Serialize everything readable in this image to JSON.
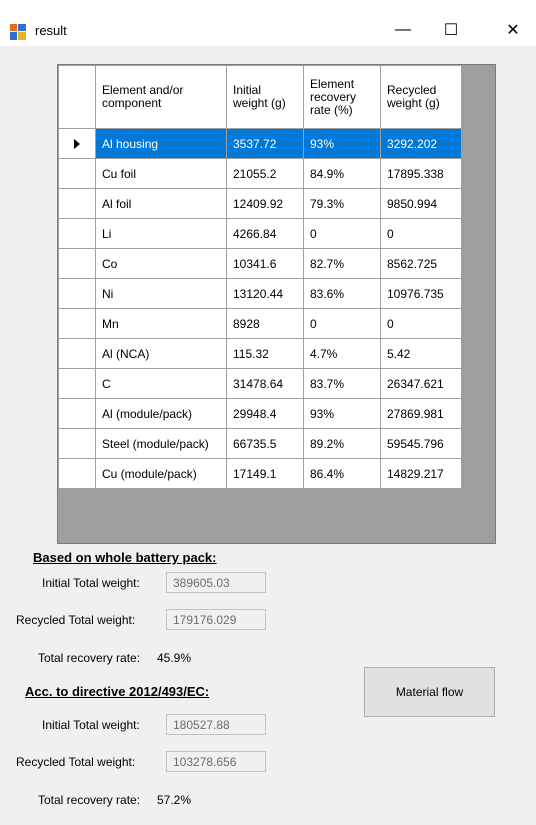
{
  "window": {
    "title": "result",
    "minimize_glyph": "—",
    "maximize_glyph": "☐",
    "close_glyph": "✕"
  },
  "table": {
    "headers": [
      "Element and/or component",
      "Initial weight (g)",
      "Element recovery rate (%)",
      "Recycled weight (g)"
    ],
    "header_lines": [
      [
        "Element and/or",
        "component"
      ],
      [
        "Initial",
        "weight (g)"
      ],
      [
        "Element",
        "recovery",
        "rate (%)"
      ],
      [
        "Recycled",
        "weight (g)"
      ]
    ],
    "rows": [
      [
        "Al housing",
        "3537.72",
        "93%",
        "3292.202"
      ],
      [
        "Cu foil",
        "21055.2",
        "84.9%",
        "17895.338"
      ],
      [
        "Al foil",
        "12409.92",
        "79.3%",
        "9850.994"
      ],
      [
        "Li",
        "4266.84",
        "0",
        "0"
      ],
      [
        "Co",
        "10341.6",
        "82.7%",
        "8562.725"
      ],
      [
        "Ni",
        "13120.44",
        "83.6%",
        "10976.735"
      ],
      [
        "Mn",
        "8928",
        "0",
        "0"
      ],
      [
        "Al (NCA)",
        "115.32",
        "4.7%",
        "5.42"
      ],
      [
        "C",
        "31478.64",
        "83.7%",
        "26347.621"
      ],
      [
        "Al (module/pack)",
        "29948.4",
        "93%",
        "27869.981"
      ],
      [
        "Steel (module/pack)",
        "66735.5",
        "89.2%",
        "59545.796"
      ],
      [
        "Cu (module/pack)",
        "17149.1",
        "86.4%",
        "14829.217"
      ]
    ],
    "selected_row": 0
  },
  "whole_pack": {
    "title": "Based on whole battery pack:",
    "initial_label": "Initial Total weight:",
    "initial_value": "389605.03",
    "recycled_label": "Recycled Total weight:",
    "recycled_value": "179176.029",
    "rate_label": "Total recovery rate:",
    "rate_value": "45.9%"
  },
  "directive": {
    "title": "Acc. to directive 2012/493/EC:",
    "initial_label": "Initial Total weight:",
    "initial_value": "180527.88",
    "recycled_label": "Recycled Total weight:",
    "recycled_value": "103278.656",
    "rate_label": "Total recovery rate:",
    "rate_value": "57.2%"
  },
  "buttons": {
    "material_flow": "Material flow"
  }
}
